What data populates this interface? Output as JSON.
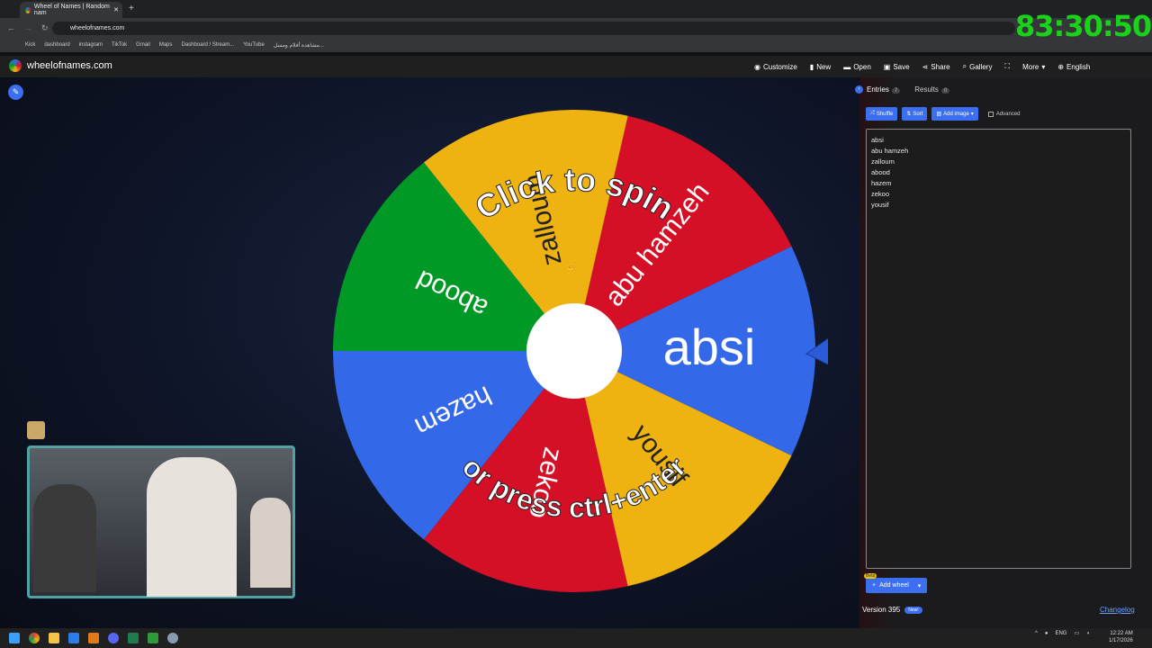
{
  "browser": {
    "tab_title": "Wheel of Names | Random nam",
    "url": "wheelofnames.com",
    "bookmarks": [
      "Kick",
      "dashboard",
      "instagram",
      "TikTok",
      "Gmail",
      "Maps",
      "Dashboard / Stream...",
      "YouTube",
      "مشاهدة أفلام ومسل..."
    ]
  },
  "overlay": {
    "timer": "83:30:50"
  },
  "app": {
    "site_name": "wheelofnames.com",
    "menu": [
      "Customize",
      "New",
      "Open",
      "Save",
      "Share",
      "Gallery",
      "More",
      "English"
    ]
  },
  "wheel": {
    "spin_hint_top": "Click to spin",
    "spin_hint_bottom": "or press ctrl+enter",
    "slice_colors": [
      "#3369e8",
      "#d50f25",
      "#eeb211",
      "#009925"
    ],
    "slices": [
      "absi",
      "abu hamzeh",
      "zalloum",
      "abood",
      "hazem",
      "zekoo",
      "yousif"
    ]
  },
  "sidebar": {
    "tabs": [
      {
        "label": "Entries",
        "count": "7"
      },
      {
        "label": "Results",
        "count": "0"
      }
    ],
    "buttons": {
      "shuffle": "Shuffle",
      "sort": "Sort",
      "add_image": "Add image",
      "advanced": "Advanced"
    },
    "entries": [
      "absi",
      "abu hamzeh",
      "zalloum",
      "abood",
      "hazem",
      "zekoo",
      "yousif"
    ],
    "add_wheel": "Add wheel",
    "beta": "Beta",
    "version": "Version 395",
    "new_badge": "New!",
    "changelog": "Changelog"
  },
  "taskbar": {
    "lang": "ENG",
    "time": "12:22 AM",
    "date": "1/17/2026"
  }
}
